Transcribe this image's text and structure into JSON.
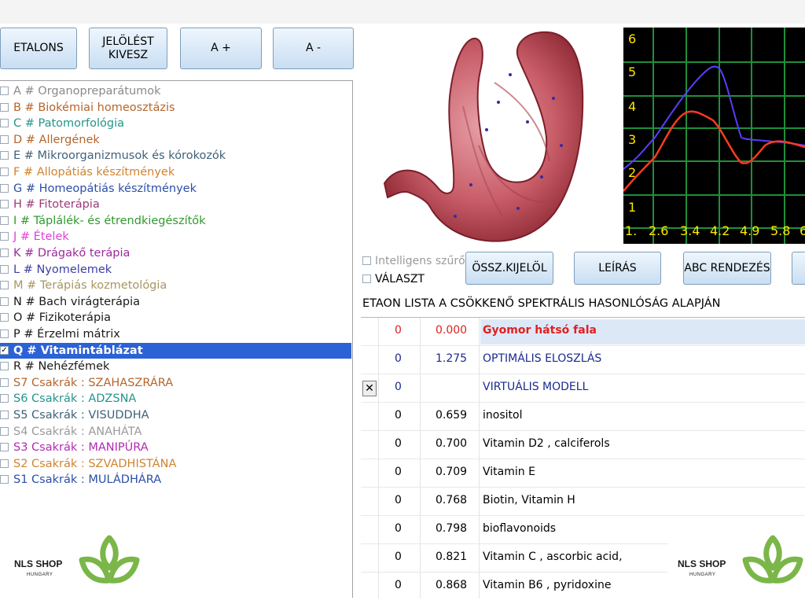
{
  "toolbar": {
    "etalons": "ETALONS",
    "jeloles_line1": "JELÖLÉST",
    "jeloles_line2": "KIVESZ",
    "a_plus": "A +",
    "a_minus": "A -"
  },
  "categories": [
    {
      "label": "A # Organopreparátumok",
      "color": "#8a8a8a",
      "checked": false
    },
    {
      "label": "B # Biokémiai homeosztázis",
      "color": "#b5652c",
      "checked": false
    },
    {
      "label": "C # Patomorfológia",
      "color": "#23958a",
      "checked": false
    },
    {
      "label": "D # Allergének",
      "color": "#b5652c",
      "checked": false
    },
    {
      "label": "E # Mikroorganizmusok és kórokozók",
      "color": "#3f6178",
      "checked": false
    },
    {
      "label": "F # Allopátiás készítmények",
      "color": "#d08430",
      "checked": false
    },
    {
      "label": "G # Homeopátiás készítmények",
      "color": "#2b4fa6",
      "checked": false
    },
    {
      "label": "H # Fitoterápia",
      "color": "#9b3b7a",
      "checked": false
    },
    {
      "label": "I # Táplálék- és étrendkiegészítők",
      "color": "#2f9a2f",
      "checked": false
    },
    {
      "label": "J # Ételek",
      "color": "#e33fd8",
      "checked": false
    },
    {
      "label": "K # Drágakő terápia",
      "color": "#9b2a9b",
      "checked": false
    },
    {
      "label": "L # Nyomelemek",
      "color": "#3d3da8",
      "checked": false
    },
    {
      "label": "M # Terápiás kozmetológia",
      "color": "#a89660",
      "checked": false
    },
    {
      "label": "N # Bach virágterápia",
      "color": "#1a1a1a",
      "checked": false
    },
    {
      "label": "O # Fizikoterápia",
      "color": "#1a1a1a",
      "checked": false
    },
    {
      "label": "P # Érzelmi mátrix",
      "color": "#1a1a1a",
      "checked": false
    },
    {
      "label": "Q # Vitamintáblázat",
      "color": "#ffffff",
      "checked": true,
      "selected": true
    },
    {
      "label": "R # Nehézfémek",
      "color": "#1a1a1a",
      "checked": false
    },
    {
      "label": "S7 Csakrák : SZAHASZRÁRA",
      "color": "#b5652c",
      "checked": false
    },
    {
      "label": "S6 Csakrák : ADZSNA",
      "color": "#23958a",
      "checked": false
    },
    {
      "label": "S5 Csakrák : VISUDDHA",
      "color": "#3f6178",
      "checked": false
    },
    {
      "label": "S4 Csakrák : ANAHÁTA",
      "color": "#9a9a9a",
      "checked": false
    },
    {
      "label": "S3 Csakrák : MANIPÚRA",
      "color": "#b22bb2",
      "checked": false
    },
    {
      "label": "S2 Csakrák : SZVADHISTÁNA",
      "color": "#d08430",
      "checked": false
    },
    {
      "label": "S1 Csakrák : MULÁDHÁRA",
      "color": "#2b4fa6",
      "checked": false
    }
  ],
  "graph": {
    "y_ticks": [
      "6",
      "5",
      "4",
      "3",
      "2",
      "1"
    ],
    "x_ticks": [
      "1.",
      "2.6",
      "3.4",
      "4.2",
      "4.9",
      "5.8",
      "6"
    ],
    "colors": {
      "background": "#000000",
      "grid": "#1f8f3a",
      "text": "#ffe600",
      "blue_series": "#5a3cff",
      "red_series": "#ff3a1f"
    }
  },
  "controls": {
    "intelligens": "Intelligens szűrő",
    "valaszt": "VÁLASZT",
    "ossz": "ÖSSZ.KIJELÖL",
    "leiras": "LEÍRÁS",
    "abc": "ABC RENDEZÉS"
  },
  "table_title": "ETAON LISTA A CSÖKKENŐ SPEKTRÁLIS HASONLÓSÁG ALAPJÁN",
  "rows": [
    {
      "n": "0",
      "v": "0.000",
      "name": "Gyomor hátsó fala",
      "style": "highlight"
    },
    {
      "n": "0",
      "v": "1.275",
      "name": "OPTIMÁLIS ELOSZLÁS",
      "style": "blue"
    },
    {
      "n": "0",
      "v": "",
      "name": "VIRTUÁLIS MODELL",
      "style": "blue",
      "marker": "✕"
    },
    {
      "n": "0",
      "v": "0.659",
      "name": "inositol",
      "style": "normal"
    },
    {
      "n": "0",
      "v": "0.700",
      "name": "Vitamin D2 , calciferols",
      "style": "normal"
    },
    {
      "n": "0",
      "v": "0.709",
      "name": "Vitamin E",
      "style": "normal"
    },
    {
      "n": "0",
      "v": "0.768",
      "name": "Biotin, Vitamin H",
      "style": "normal"
    },
    {
      "n": "0",
      "v": "0.798",
      "name": "bioflavonoids",
      "style": "normal"
    },
    {
      "n": "0",
      "v": "0.821",
      "name": "Vitamin C , ascorbic acid,",
      "style": "normal"
    },
    {
      "n": "0",
      "v": "0.868",
      "name": "Vitamin B6 , pyridoxine",
      "style": "normal"
    }
  ],
  "logo": {
    "name": "NLS SHOP",
    "sub": "HUNGARY",
    "color": "#7ab648"
  }
}
